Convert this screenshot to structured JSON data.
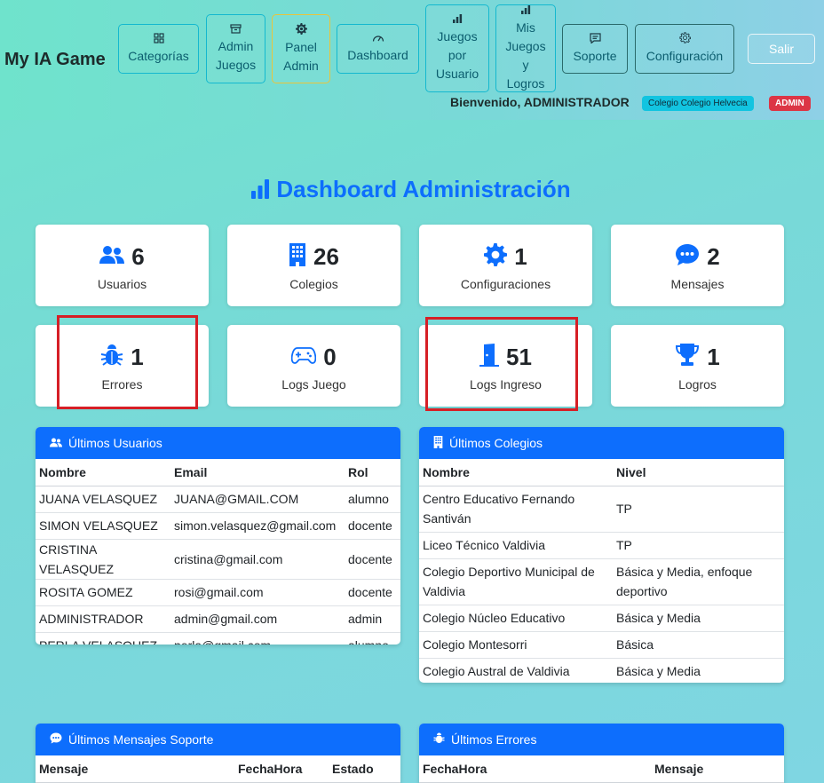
{
  "brand": "My IA Game",
  "nav": [
    {
      "label": "Categorías",
      "icon": "grid-icon"
    },
    {
      "label": "Admin\nJuegos",
      "icon": "archive-icon"
    },
    {
      "label": "Panel\nAdmin",
      "icon": "gear-icon"
    },
    {
      "label": "Dashboard",
      "icon": "speedometer-icon"
    },
    {
      "label": "Juegos\npor\nUsuario",
      "icon": "bar-chart-icon"
    },
    {
      "label": "Mis\nJuegos\ny\nLogros",
      "icon": "bar-chart-icon"
    },
    {
      "label": "Soporte",
      "icon": "message-icon"
    },
    {
      "label": "Configuración",
      "icon": "gear-icon"
    },
    {
      "label": "Salir"
    }
  ],
  "welcome": "Bienvenido, ADMINISTRADOR",
  "school_badge": "Colegio Colegio Helvecia",
  "role_badge": "ADMIN",
  "title": "Dashboard Administración",
  "stats": [
    {
      "value": "6",
      "label": "Usuarios",
      "icon": "users-icon"
    },
    {
      "value": "26",
      "label": "Colegios",
      "icon": "building-icon"
    },
    {
      "value": "1",
      "label": "Configuraciones",
      "icon": "gear-icon"
    },
    {
      "value": "2",
      "label": "Mensajes",
      "icon": "chat-icon"
    },
    {
      "value": "1",
      "label": "Errores",
      "icon": "bug-icon"
    },
    {
      "value": "0",
      "label": "Logs Juego",
      "icon": "gamepad-icon"
    },
    {
      "value": "51",
      "label": "Logs Ingreso",
      "icon": "door-icon"
    },
    {
      "value": "1",
      "label": "Logros",
      "icon": "trophy-icon"
    }
  ],
  "users_panel": {
    "title": "Últimos Usuarios",
    "headers": [
      "Nombre",
      "Email",
      "Rol"
    ],
    "rows": [
      [
        "JUANA VELASQUEZ",
        "JUANA@GMAIL.COM",
        "alumno"
      ],
      [
        "SIMON VELASQUEZ",
        "simon.velasquez@gmail.com",
        "docente"
      ],
      [
        "CRISTINA VELASQUEZ",
        "cristina@gmail.com",
        "docente"
      ],
      [
        "ROSITA GOMEZ",
        "rosi@gmail.com",
        "docente"
      ],
      [
        "ADMINISTRADOR",
        "admin@gmail.com",
        "admin"
      ],
      [
        "PERLA VELASQUEZ",
        "perla@gmail.com",
        "alumno"
      ]
    ]
  },
  "schools_panel": {
    "title": "Últimos Colegios",
    "headers": [
      "Nombre",
      "Nivel"
    ],
    "rows": [
      [
        "Centro Educativo Fernando Santiván",
        "TP"
      ],
      [
        "Liceo Técnico Valdivia",
        "TP"
      ],
      [
        "Colegio Deportivo Municipal de Valdivia",
        "Básica y Media, enfoque deportivo"
      ],
      [
        "Colegio Núcleo Educativo",
        "Básica y Media"
      ],
      [
        "Colegio Montesorri",
        "Básica"
      ],
      [
        "Colegio Austral de Valdivia",
        "Básica y Media"
      ]
    ]
  },
  "messages_panel": {
    "title": "Últimos Mensajes Soporte",
    "headers": [
      "Mensaje",
      "FechaHora",
      "Estado"
    ]
  },
  "errors_panel": {
    "title": "Últimos Errores",
    "headers": [
      "FechaHora",
      "Mensaje"
    ]
  },
  "colors": {
    "primary": "#0d6efd",
    "danger": "#dc3545",
    "info": "#12c4e0"
  }
}
